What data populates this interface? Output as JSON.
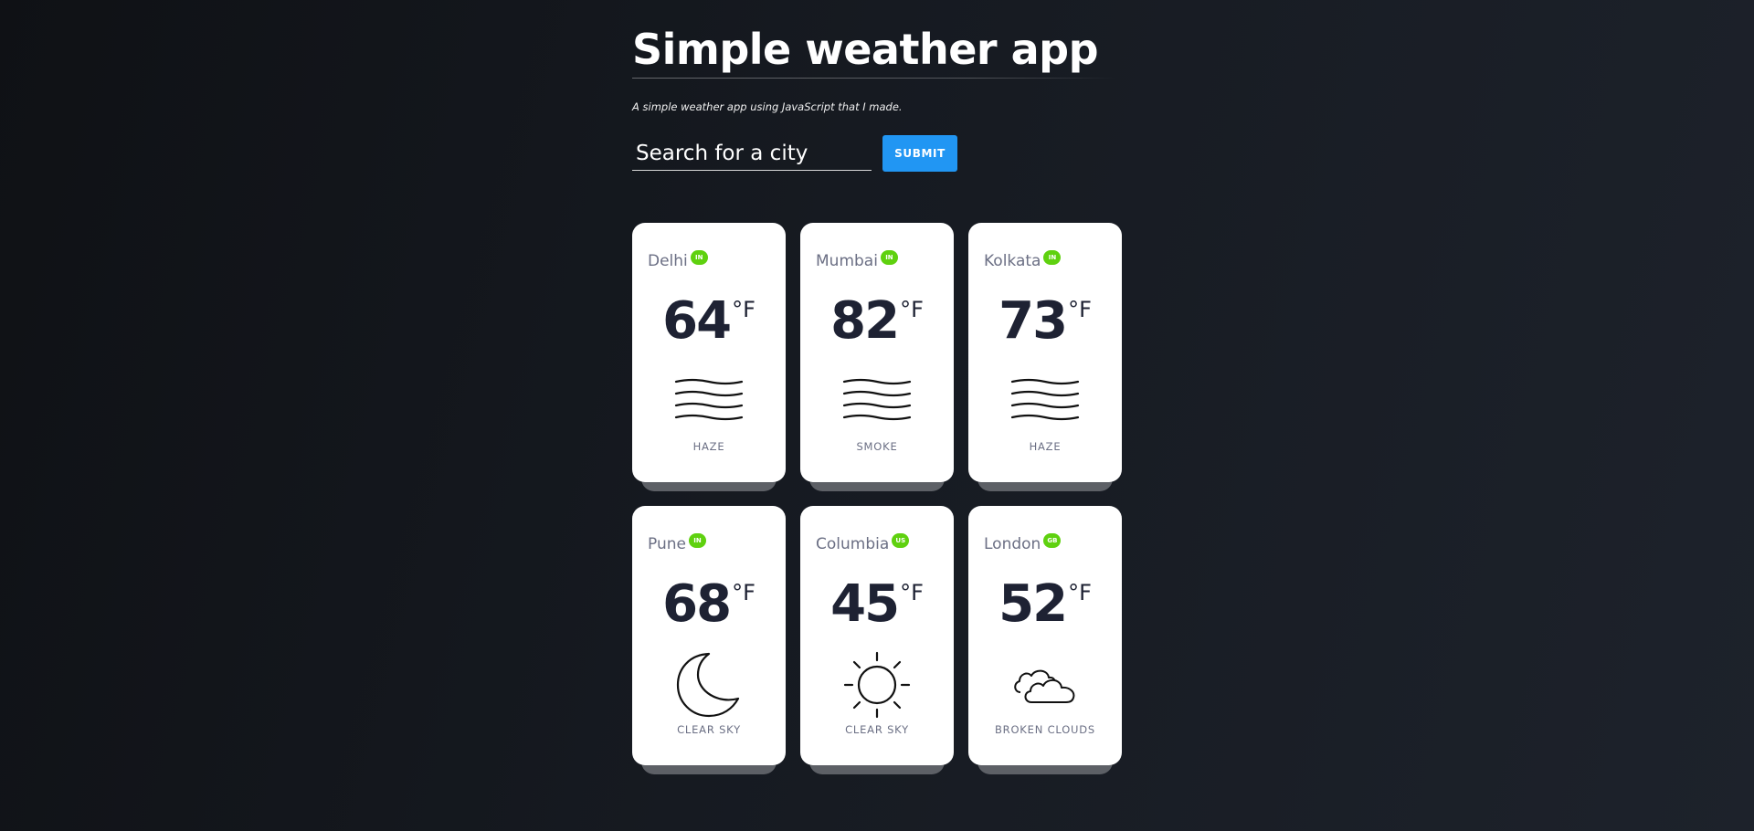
{
  "header": {
    "title": "Simple weather app",
    "subtitle": "A simple weather app using JavaScript that I made."
  },
  "search": {
    "placeholder": "Search for a city",
    "value": "",
    "submit_label": "SUBMIT",
    "submit_color": "#2196f3"
  },
  "cards": [
    {
      "city": "Delhi",
      "country": "IN",
      "temp": "64",
      "unit": "°F",
      "condition": "HAZE",
      "icon": "haze-icon"
    },
    {
      "city": "Mumbai",
      "country": "IN",
      "temp": "82",
      "unit": "°F",
      "condition": "SMOKE",
      "icon": "haze-icon"
    },
    {
      "city": "Kolkata",
      "country": "IN",
      "temp": "73",
      "unit": "°F",
      "condition": "HAZE",
      "icon": "haze-icon"
    },
    {
      "city": "Pune",
      "country": "IN",
      "temp": "68",
      "unit": "°F",
      "condition": "CLEAR SKY",
      "icon": "moon-icon"
    },
    {
      "city": "Columbia",
      "country": "US",
      "temp": "45",
      "unit": "°F",
      "condition": "CLEAR SKY",
      "icon": "sun-icon"
    },
    {
      "city": "London",
      "country": "GB",
      "temp": "52",
      "unit": "°F",
      "condition": "BROKEN CLOUDS",
      "icon": "broken-clouds-icon"
    }
  ],
  "colors": {
    "badge": "#5fd10f",
    "card_background": "#ffffff",
    "temperature_text": "#1e2233",
    "muted_text": "#6b6f84"
  }
}
